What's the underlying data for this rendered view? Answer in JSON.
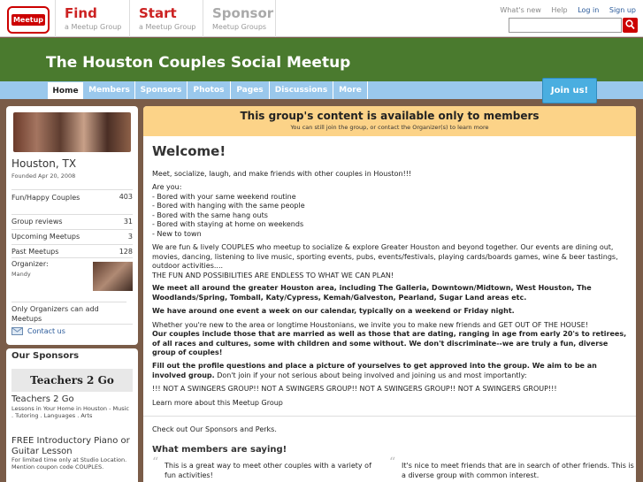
{
  "topnav": {
    "logo": "Meetup",
    "tabs": [
      {
        "title": "Find",
        "sub": "a Meetup Group",
        "color": "#cc2222"
      },
      {
        "title": "Start",
        "sub": "a Meetup Group",
        "color": "#cc2222"
      },
      {
        "title": "Sponsor",
        "sub": "Meetup Groups",
        "color": "#aaaaaa"
      }
    ],
    "links": {
      "whats_new": "What's new",
      "help": "Help",
      "login": "Log in",
      "signup": "Sign up"
    },
    "search_placeholder": ""
  },
  "group": {
    "title": "The Houston Couples Social Meetup",
    "tabs": [
      "Home",
      "Members",
      "Sponsors",
      "Photos",
      "Pages",
      "Discussions",
      "More"
    ],
    "join": "Join us!"
  },
  "sidebar": {
    "city": "Houston, TX",
    "founded": "Founded Apr 20, 2008",
    "stats": [
      {
        "label": "Fun/Happy Couples",
        "value": "403"
      },
      {
        "label": "Group reviews",
        "value": "31"
      },
      {
        "label": "Upcoming Meetups",
        "value": "3"
      },
      {
        "label": "Past Meetups",
        "value": "128"
      }
    ],
    "organizer_label": "Organizer:",
    "organizer_name": "Mandy",
    "only_organizers": "Only Organizers can add Meetups",
    "contact": "Contact us",
    "sponsors_heading": "Our Sponsors",
    "sponsor_logo": "Teachers 2 Go",
    "sponsor_name": "Teachers 2 Go",
    "sponsor_desc": "Lessons in Your Home in Houston - Music . Tutoring . Languages . Arts",
    "offer_title": "FREE Introductory Piano or Guitar Lesson",
    "offer_desc": "For limited time only at Studio Location. Mention coupon code COUPLES."
  },
  "notice": {
    "title": "This group's content is available only to members",
    "sub": "You can still join the group, or contact the Organizer(s) to learn more"
  },
  "main": {
    "heading": "Welcome!",
    "p1": "Meet, socialize, laugh, and make friends with other couples in Houston!!!",
    "p2": "Are you:\n- Bored with your same weekend routine\n- Bored with hanging with the same people\n- Bored with the same hang outs\n- Bored with staying at home on weekends\n- New to town",
    "p3": "We are fun & lively COUPLES who meetup to socialize & explore Greater Houston and beyond together. Our events are dining out, movies, dancing, listening to live music, sporting events, pubs, events/festivals, playing cards/boards games, wine & beer tastings, outdoor activities....\nTHE FUN AND POSSIBILITIES ARE ENDLESS TO WHAT WE CAN PLAN!",
    "p4": "We meet all around the greater Houston area, including The Galleria, Downtown/Midtown, West Houston, The Woodlands/Spring, Tomball, Katy/Cypress, Kemah/Galveston, Pearland, Sugar Land areas etc.",
    "p5": "We have around one event a week on our calendar, typically on a weekend or Friday night.",
    "p6": "Whether you're new to the area or longtime Houstonians, we invite you to make new friends and GET OUT OF THE HOUSE!",
    "p7": "Our couples include those that are married as well as those that are dating, ranging in age from early 20's to retirees, of all races and cultures, some with children and some without.  We don't discriminate--we are truly a fun, diverse group of couples!",
    "p8a": "Fill out the profile questions and place a picture of yourselves to get approved into the group. We aim to be an involved group.",
    "p8b": " Don't join if your not serious about being involved and joining us and most importantly:",
    "p9": "!!! NOT A SWINGERS GROUP!! NOT A SWINGERS GROUP!! NOT A SWINGERS GROUP!! NOT A SWINGERS GROUP!!!",
    "p10": "Learn more about this Meetup Group",
    "p11": "Check out Our Sponsors and Perks.",
    "members_heading": "What members are saying!",
    "quotes": [
      "This is a great way to meet other couples with a variety of fun activities!",
      "It's nice to meet friends that are in search of other friends. This is a diverse group with common interest."
    ]
  },
  "colors": {
    "banner": "#4a7a2e",
    "tabbar": "#9ac8ec",
    "notice": "#fcd388",
    "background": "#7a5c48",
    "accent": "#cc2222"
  }
}
